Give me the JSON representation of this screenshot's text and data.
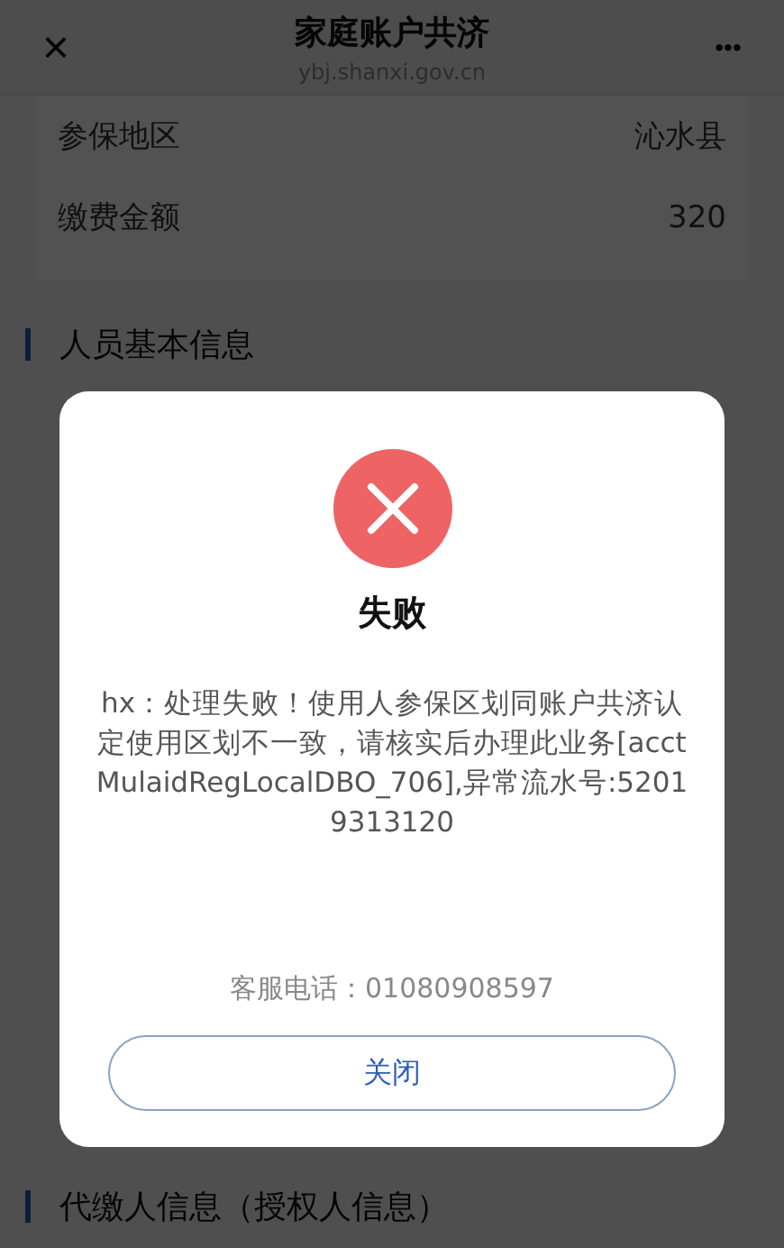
{
  "header": {
    "close": "×",
    "title": "家庭账户共济",
    "url": "ybj.shanxi.gov.cn",
    "more": "•••"
  },
  "info_rows": [
    {
      "label": "参保地区",
      "value": "沁水县"
    },
    {
      "label": "缴费金额",
      "value": "320"
    }
  ],
  "sections": [
    {
      "title": "人员基本信息"
    },
    {
      "title": "代缴人信息（授权人信息）"
    }
  ],
  "dialog": {
    "title": "失败",
    "message": "hx：处理失败！使用人参保区划同账户共济认定使用区划不一致，请核实后办理此业务[acctMulaidRegLocalDBO_706],异常流水号:52019313120",
    "hotline": "客服电话：01080908597",
    "button": "关闭"
  }
}
